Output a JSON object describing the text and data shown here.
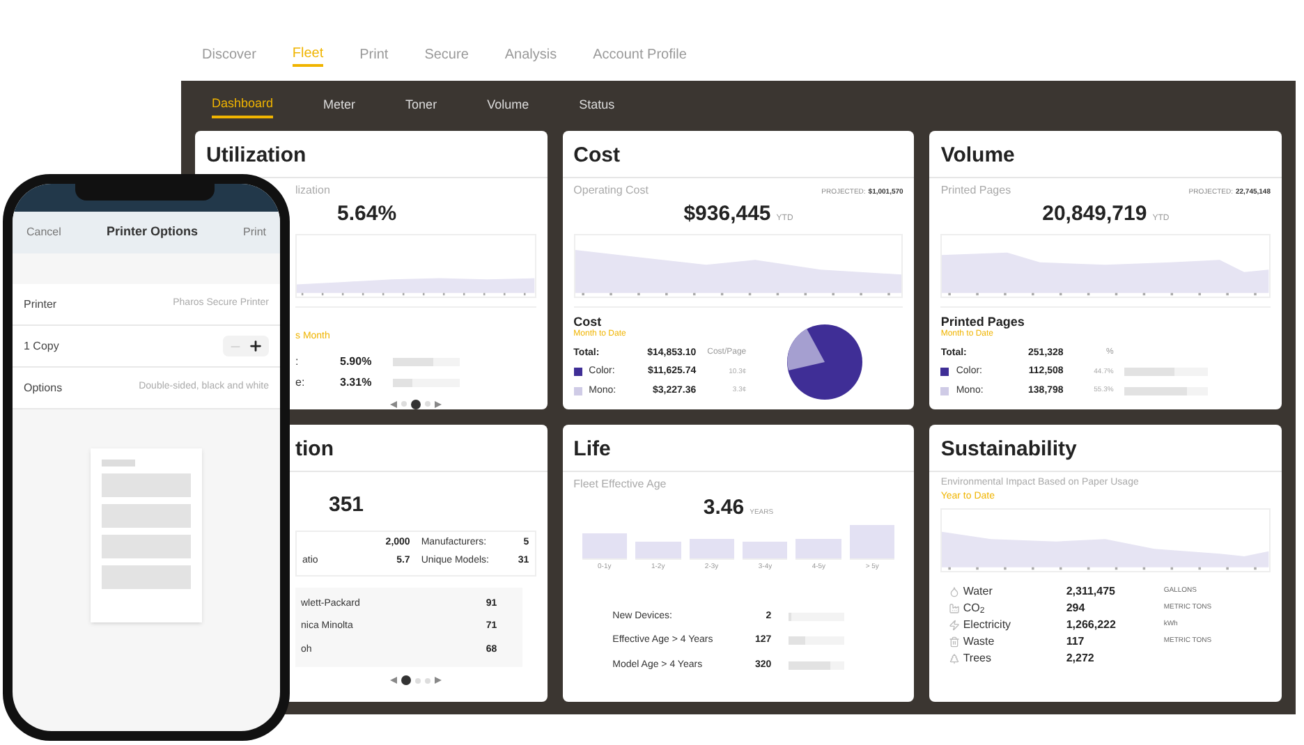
{
  "nav": {
    "tabs": [
      {
        "label": "Discover",
        "selected": false
      },
      {
        "label": "Fleet",
        "selected": true
      },
      {
        "label": "Print",
        "selected": false
      },
      {
        "label": "Secure",
        "selected": false
      },
      {
        "label": "Analysis",
        "selected": false
      },
      {
        "label": "Account Profile",
        "selected": false
      }
    ]
  },
  "subnav": {
    "tabs": [
      {
        "label": "Dashboard",
        "selected": true
      },
      {
        "label": "Meter",
        "selected": false
      },
      {
        "label": "Toner",
        "selected": false
      },
      {
        "label": "Volume",
        "selected": false
      },
      {
        "label": "Status",
        "selected": false
      }
    ]
  },
  "utilization": {
    "title": "Utilization",
    "label": "lization",
    "value": "5.64%",
    "period": "s Month",
    "rows": [
      {
        "label": ":",
        "value": "5.90%",
        "level": 0.6
      },
      {
        "label": "e:",
        "value": "3.31%",
        "level": 0.3
      }
    ],
    "pager": [
      {
        "selected": false
      },
      {
        "selected": true
      },
      {
        "selected": false
      }
    ]
  },
  "cost": {
    "title": "Cost",
    "label": "Operating Cost",
    "projected_label": "PROJECTED:",
    "projected_value": "$1,001,570",
    "value": "$936,445",
    "unit": "YTD",
    "section": "Cost",
    "period": "Month to Date",
    "total": {
      "label": "Total:",
      "value": "$14,853.10",
      "extra": "Cost/Page"
    },
    "rows": [
      {
        "label": "Color:",
        "value": "$11,625.74",
        "extra": "10.3¢",
        "color": "#3f2e96"
      },
      {
        "label": "Mono:",
        "value": "$3,227.36",
        "extra": "3.3¢",
        "color": "#cfcbe6"
      }
    ]
  },
  "volume": {
    "title": "Volume",
    "label": "Printed Pages",
    "projected_label": "PROJECTED:",
    "projected_value": "22,745,148",
    "value": "20,849,719",
    "unit": "YTD",
    "section": "Printed Pages",
    "period": "Month to Date",
    "total": {
      "label": "Total:",
      "value": "251,328",
      "extra": "%"
    },
    "rows": [
      {
        "label": "Color:",
        "value": "112,508",
        "extra": "44.7%",
        "color": "#3f2e96",
        "level": 0.6
      },
      {
        "label": "Mono:",
        "value": "138,798",
        "extra": "55.3%",
        "color": "#cfcbe6",
        "level": 0.75
      }
    ]
  },
  "composition": {
    "title": "tion",
    "value": "351",
    "stats_left": [
      {
        "value": "2,000"
      },
      {
        "label": "atio",
        "value": "5.7"
      }
    ],
    "stats_right": [
      {
        "label": "Manufacturers:",
        "value": "5"
      },
      {
        "label": "Unique Models:",
        "value": "31"
      }
    ],
    "makers": [
      {
        "name": "wlett-Packard",
        "count": "91"
      },
      {
        "name": "nica Minolta",
        "count": "71"
      },
      {
        "name": "oh",
        "count": "68"
      }
    ],
    "pager": [
      {
        "selected": true
      },
      {
        "selected": false
      },
      {
        "selected": false
      }
    ]
  },
  "life": {
    "title": "Life",
    "label": "Fleet Effective Age",
    "value": "3.46",
    "unit": "YEARS",
    "age_buckets": [
      "0-1y",
      "1-2y",
      "2-3y",
      "3-4y",
      "4-5y",
      "> 5y"
    ],
    "rows": [
      {
        "label": "New Devices:",
        "value": "2",
        "level": 0.05
      },
      {
        "label": "Effective Age > 4 Years",
        "value": "127",
        "level": 0.3
      },
      {
        "label": "Model Age > 4 Years",
        "value": "320",
        "level": 0.75
      }
    ]
  },
  "sustainability": {
    "title": "Sustainability",
    "label": "Environmental Impact Based on Paper Usage",
    "period": "Year to Date",
    "rows": [
      {
        "kind": "water",
        "label": "Water",
        "value": "2,311,475",
        "unit": "GALLONS"
      },
      {
        "kind": "co2",
        "label": "CO$_{2}$",
        "value": "294",
        "unit": "METRIC TONS"
      },
      {
        "kind": "electricity",
        "label": "Electricity",
        "value": "1,266,222",
        "unit": "kWh"
      },
      {
        "kind": "waste",
        "label": "Waste",
        "value": "117",
        "unit": "METRIC TONS"
      },
      {
        "kind": "trees",
        "label": "Trees",
        "value": "2,272"
      }
    ]
  },
  "phone": {
    "cancel": "Cancel",
    "title": "Printer Options",
    "print": "Print",
    "rows": [
      {
        "kind": "value",
        "label": "Printer",
        "value": "Pharos Secure Printer"
      },
      {
        "kind": "stepper",
        "label": "1 Copy"
      },
      {
        "kind": "value",
        "label": "Options",
        "value": "Double-sided, black and white"
      }
    ]
  }
}
